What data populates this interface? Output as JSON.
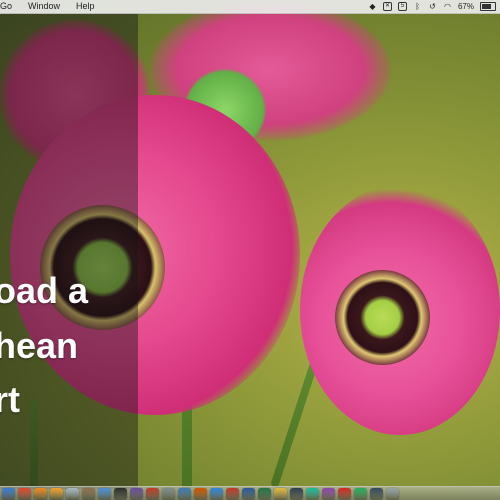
{
  "menubar": {
    "items": [
      {
        "label": "Go"
      },
      {
        "label": "Window"
      },
      {
        "label": "Help"
      }
    ],
    "status": {
      "battery_percent": "67%",
      "icons": [
        "dropbox-icon",
        "close-box-icon",
        "five-box-icon",
        "bluetooth-icon",
        "time-machine-icon",
        "wifi-icon",
        "battery-icon"
      ]
    }
  },
  "slide": {
    "line1": "oad a",
    "line2": "hean",
    "line3": "rt"
  },
  "dock": {
    "icons": [
      {
        "name": "finder-icon",
        "color": "#3a7bd5"
      },
      {
        "name": "chrome-icon",
        "color": "#e04a2f"
      },
      {
        "name": "cone-icon",
        "color": "#f08a1c"
      },
      {
        "name": "vlc-icon",
        "color": "#f3a22b"
      },
      {
        "name": "preview-icon",
        "color": "#a8b8c8"
      },
      {
        "name": "photos-icon",
        "color": "#8f6f4f"
      },
      {
        "name": "browser-icon",
        "color": "#4a90d9"
      },
      {
        "name": "app-icon-8",
        "color": "#2b2b2b"
      },
      {
        "name": "app-icon-9",
        "color": "#6a4c9c"
      },
      {
        "name": "presentation-icon",
        "color": "#c0392b"
      },
      {
        "name": "app-icon-11",
        "color": "#7f8c8d"
      },
      {
        "name": "app-icon-12",
        "color": "#3d7ab8"
      },
      {
        "name": "app-icon-13",
        "color": "#d35400"
      },
      {
        "name": "safari-icon",
        "color": "#2e86de"
      },
      {
        "name": "app-icon-15",
        "color": "#c0392b"
      },
      {
        "name": "word-icon",
        "color": "#2b579a"
      },
      {
        "name": "excel-icon",
        "color": "#217346"
      },
      {
        "name": "app-icon-18",
        "color": "#e2b93b"
      },
      {
        "name": "app-icon-19",
        "color": "#2c3e50"
      },
      {
        "name": "app-icon-20",
        "color": "#1abc9c"
      },
      {
        "name": "app-icon-21",
        "color": "#8e44ad"
      },
      {
        "name": "acrobat-icon",
        "color": "#d6281f"
      },
      {
        "name": "app-icon-23",
        "color": "#27ae60"
      },
      {
        "name": "app-icon-24",
        "color": "#34495e"
      },
      {
        "name": "app-icon-25",
        "color": "#95a5a6"
      }
    ]
  }
}
